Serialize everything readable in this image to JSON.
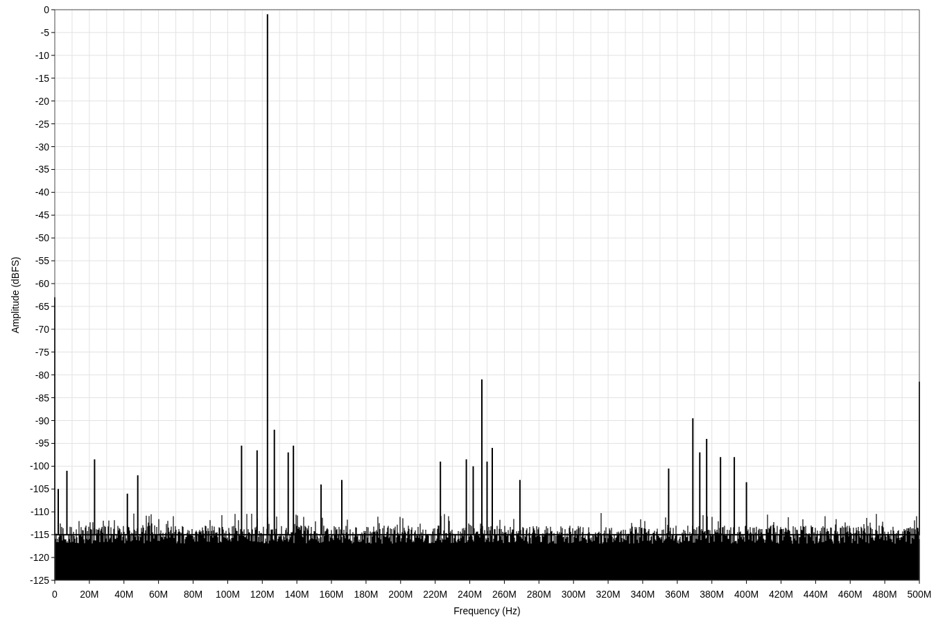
{
  "chart": {
    "chart_data": {
      "type": "line",
      "xlabel": "Frequency (Hz)",
      "ylabel": "Amplitude (dBFS)",
      "xlim": [
        0,
        500
      ],
      "ylim": [
        -125,
        0
      ],
      "xticks": [
        {
          "value": 0,
          "label": "0"
        },
        {
          "value": 20,
          "label": "20M"
        },
        {
          "value": 40,
          "label": "40M"
        },
        {
          "value": 60,
          "label": "60M"
        },
        {
          "value": 80,
          "label": "80M"
        },
        {
          "value": 100,
          "label": "100M"
        },
        {
          "value": 120,
          "label": "120M"
        },
        {
          "value": 140,
          "label": "140M"
        },
        {
          "value": 160,
          "label": "160M"
        },
        {
          "value": 180,
          "label": "180M"
        },
        {
          "value": 200,
          "label": "200M"
        },
        {
          "value": 220,
          "label": "220M"
        },
        {
          "value": 240,
          "label": "240M"
        },
        {
          "value": 260,
          "label": "260M"
        },
        {
          "value": 280,
          "label": "280M"
        },
        {
          "value": 300,
          "label": "300M"
        },
        {
          "value": 320,
          "label": "320M"
        },
        {
          "value": 340,
          "label": "340M"
        },
        {
          "value": 360,
          "label": "360M"
        },
        {
          "value": 380,
          "label": "380M"
        },
        {
          "value": 400,
          "label": "400M"
        },
        {
          "value": 420,
          "label": "420M"
        },
        {
          "value": 440,
          "label": "440M"
        },
        {
          "value": 460,
          "label": "460M"
        },
        {
          "value": 480,
          "label": "480M"
        },
        {
          "value": 500,
          "label": "500M"
        }
      ],
      "yticks": [
        0,
        -5,
        -10,
        -15,
        -20,
        -25,
        -30,
        -35,
        -40,
        -45,
        -50,
        -55,
        -60,
        -65,
        -70,
        -75,
        -80,
        -85,
        -90,
        -95,
        -100,
        -105,
        -110,
        -115,
        -120,
        -125
      ],
      "grid": true,
      "x": [
        0,
        0,
        2,
        2,
        2,
        7,
        7,
        7,
        23,
        23,
        23,
        42,
        42,
        42,
        48,
        48,
        48,
        108,
        108,
        108,
        117,
        117,
        117,
        123,
        123,
        123,
        127,
        127,
        127,
        135,
        135,
        135,
        138,
        138,
        138,
        154,
        154,
        154,
        166,
        166,
        166,
        223,
        223,
        223,
        238,
        238,
        238,
        242,
        242,
        242,
        247,
        247,
        247,
        250,
        250,
        250,
        253,
        253,
        253,
        269,
        269,
        269,
        355,
        355,
        355,
        369,
        369,
        369,
        373,
        373,
        373,
        377,
        377,
        377,
        385,
        385,
        385,
        393,
        393,
        393,
        400,
        400,
        400,
        500,
        500
      ],
      "series": [
        {
          "color": "#000000",
          "values": [
            -63,
            -115,
            -115,
            -105,
            -115,
            -115,
            -101,
            -115,
            -115,
            -98.5,
            -115,
            -115,
            -106,
            -115,
            -115,
            -102,
            -115,
            -115,
            -95.5,
            -115,
            -115,
            -96.5,
            -115,
            -115,
            -1,
            -115,
            -115,
            -92,
            -115,
            -115,
            -97,
            -115,
            -115,
            -95.5,
            -115,
            -115,
            -104,
            -115,
            -115,
            -103,
            -115,
            -115,
            -99,
            -115,
            -115,
            -98.5,
            -115,
            -115,
            -100,
            -115,
            -115,
            -81,
            -115,
            -115,
            -99,
            -115,
            -115,
            -96,
            -115,
            -115,
            -103,
            -115,
            -115,
            -100.5,
            -115,
            -115,
            -89.5,
            -115,
            -115,
            -97,
            -115,
            -115,
            -94,
            -115,
            -115,
            -98,
            -115,
            -115,
            -98,
            -115,
            -115,
            -103.5,
            -115,
            -115,
            -81.5
          ]
        }
      ]
    }
  }
}
